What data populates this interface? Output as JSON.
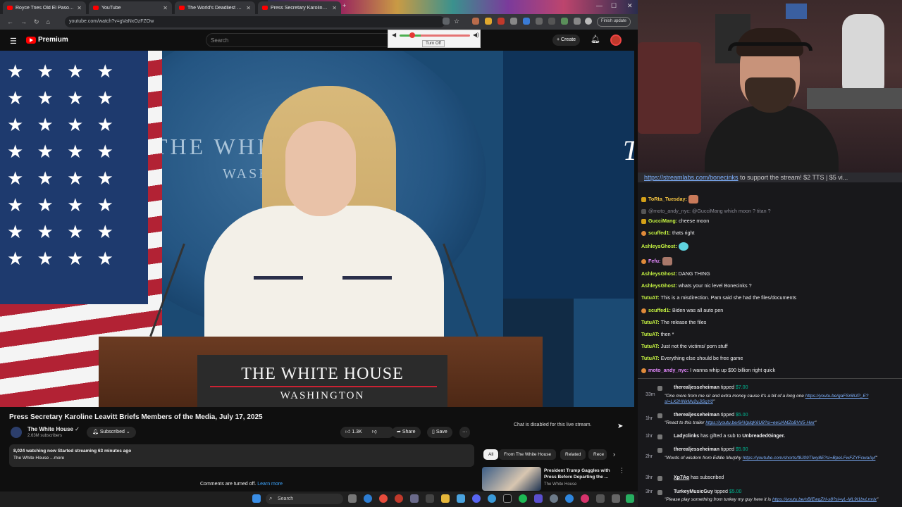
{
  "browser": {
    "tabs": [
      {
        "label": "Royce Tries Old El Paso's NEW"
      },
      {
        "label": "YouTube"
      },
      {
        "label": "The World's Deadliest Theme"
      },
      {
        "label": "Press Secretary Karoline Le"
      }
    ],
    "url": "youtube.com/watch?v=gVaNxOzFZOw",
    "finish_update": "Finish update",
    "new_tab": "+"
  },
  "volume_popup": {
    "turn_off_label": "Turn Off"
  },
  "youtube": {
    "logo": "Premium",
    "search_placeholder": "Search",
    "create_label": "Create",
    "video": {
      "backdrop_text_1": "THE WHITE HOUSE",
      "backdrop_text_2": "WASHINGTON",
      "podium_text_1": "THE WHITE HOUSE",
      "podium_text_2": "WASHINGTON",
      "corner_letter": "T"
    },
    "title": "Press Secretary Karoline Leavitt Briefs Members of the Media, July 17, 2025",
    "channel": {
      "name": "The White House",
      "subscribers": "2.63M subscribers",
      "subscribe_state": "Subscribed"
    },
    "actions": {
      "likes": "1.3K",
      "share": "Share",
      "save": "Save",
      "more": "···"
    },
    "description": {
      "line1": "8,024 watching now  Started streaming 63 minutes ago",
      "line2": "The White House ...more"
    },
    "comments_off": "Comments are turned off.",
    "learn_more": "Learn more",
    "chat_disabled": "Chat is disabled for this live stream.",
    "chips": [
      "All",
      "From The White House",
      "Related",
      "Rece"
    ],
    "recommendation": {
      "title": "President Trump Gaggles with Press Before Departing the ...",
      "channel": "The White House"
    }
  },
  "taskbar": {
    "search_label": "Search"
  },
  "stream": {
    "donation_banner_link": "https://streamlabs.com/bonecinks",
    "donation_banner_text": " to support the stream! $2 TTS | $5 vi...",
    "chat": [
      {
        "user": "ToRta_Tuesday:",
        "color": "#f5c542",
        "text": ""
      },
      {
        "user": "@moto_andy_nyc: @GucciMang which moon ? titan ?",
        "color": "#8a8a95",
        "text": ""
      },
      {
        "user": "GucciMang:",
        "color": "#c7f542",
        "text": "cheese moon"
      },
      {
        "user": "scuffed1:",
        "color": "#c7f542",
        "text": "thats right"
      },
      {
        "user": "AshleysGhost:",
        "color": "#c7f542",
        "text": ""
      },
      {
        "user": "Fefu:",
        "color": "#e58aff",
        "text": ""
      },
      {
        "user": "AshleysGhost:",
        "color": "#c7f542",
        "text": "DANG THING"
      },
      {
        "user": "AshleysGhost:",
        "color": "#c7f542",
        "text": "whats your nic level Bonecinks ?"
      },
      {
        "user": "TutuAT:",
        "color": "#c7f542",
        "text": "This is a misdirection. Pam said she had the files/documents"
      },
      {
        "user": "scuffed1:",
        "color": "#c7f542",
        "text": "Biden was all auto pen"
      },
      {
        "user": "TutuAT:",
        "color": "#c7f542",
        "text": "The release the files"
      },
      {
        "user": "TutuAT:",
        "color": "#c7f542",
        "text": "then *"
      },
      {
        "user": "TutuAT:",
        "color": "#c7f542",
        "text": "Just not the victims/ porn stuff"
      },
      {
        "user": "TutuAT:",
        "color": "#c7f542",
        "text": "Everything else should be free game"
      },
      {
        "user": "moto_andy_nyc:",
        "color": "#e58aff",
        "text": "I wanna whip up $90 billion right quick"
      }
    ],
    "events": [
      {
        "time": "33m",
        "user": "therealjesseheiman",
        "verb": " tipped ",
        "amount": "$7.00",
        "msg": "\"One more from me sir and extra money cause it's a bit of a long one ",
        "link": "https://youtu.be/gaFSr6lUP_E?si=LX2HNkMv2yJjSgY0",
        "msg_end": "\""
      },
      {
        "time": "1hr",
        "user": "therealjesseheiman",
        "verb": " tipped ",
        "amount": "$5.00",
        "msg": "\"React to this trailer ",
        "link": "https://youtu.be/6AVpIqK6U8?si=eeUAMZoBVrI5-Hwr",
        "msg_end": "\""
      },
      {
        "time": "1hr",
        "user": "Ladyclinks",
        "verb": " has gifted a sub to ",
        "amount": "UnbreadedGinger."
      },
      {
        "time": "2hr",
        "user": "therealjesseheiman",
        "verb": " tipped ",
        "amount": "$5.00",
        "msg": "\"Words of wisdom from Eddie Murphy ",
        "link": "https://youtube.com/shorts/f8J09TIwy8E?si=BpeLFwFZYFcwaAyf",
        "msg_end": "\""
      },
      {
        "time": "3hr",
        "user": "Xp7Ao",
        "verb": " has subscribed",
        "amount": ""
      },
      {
        "time": "3hr",
        "user": "TurkeyMusicGuy",
        "verb": " tipped ",
        "amount": "$5.00",
        "msg": "\"Please play something from turkey my guy here it is ",
        "link": "https://youtu.be/nBiEwgZH-x8?si=yL-ML9I1bvLmrlx",
        "msg_end": "\""
      }
    ]
  },
  "colors": {
    "yt_red": "#ff0000",
    "chat_bg": "#18181b",
    "tip_green": "#00b894",
    "link_blue": "#3ea6ff"
  }
}
